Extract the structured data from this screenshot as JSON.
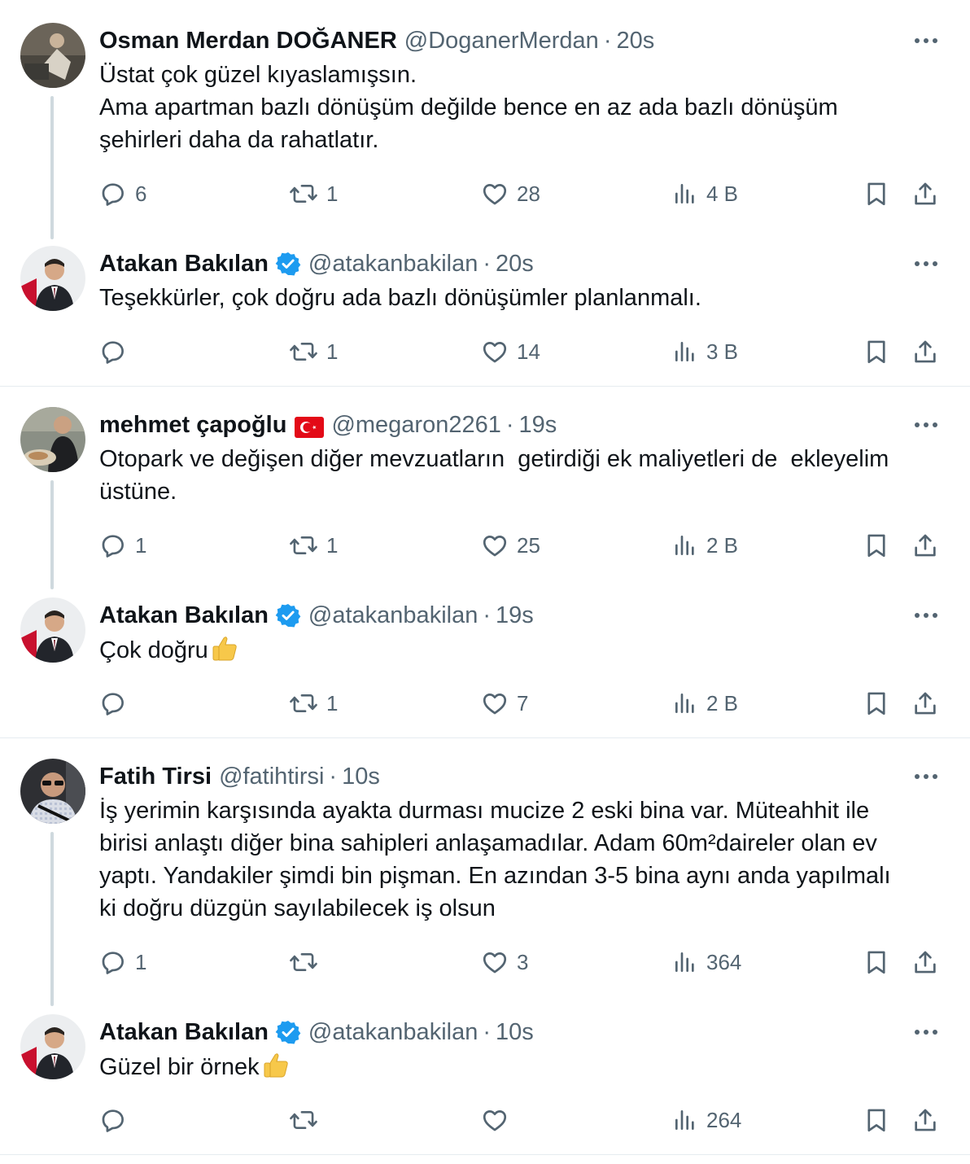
{
  "colors": {
    "text": "#0f1419",
    "muted": "#536471",
    "verified": "#1d9bf0",
    "divider": "#e6ecf0",
    "thread_line": "#cfd9de"
  },
  "tweets": [
    {
      "name": "Osman Merdan DOĞANER",
      "handle": "@DoganerMerdan",
      "time": "20s",
      "verified": false,
      "lines": [
        "Üstat çok güzel kıyaslamışsın.",
        "Ama apartman bazlı dönüşüm değilde bence en az ada bazlı dönüşüm",
        "şehirleri daha da rahatlatır."
      ],
      "replies": "6",
      "reposts": "1",
      "likes": "28",
      "views": "4 B"
    },
    {
      "name": "Atakan Bakılan",
      "handle": "@atakanbakilan",
      "time": "20s",
      "verified": true,
      "lines": [
        "Teşekkürler, çok doğru ada bazlı dönüşümler planlanmalı."
      ],
      "replies": "",
      "reposts": "1",
      "likes": "14",
      "views": "3 B"
    },
    {
      "name": "mehmet çapoğlu",
      "handle": "@megaron2261",
      "time": "19s",
      "verified": false,
      "flag": "turkey-flag",
      "lines": [
        "Otopark ve değişen diğer mevzuatların  getirdiği ek maliyetleri de  ekleyelim",
        "üstüne."
      ],
      "replies": "1",
      "reposts": "1",
      "likes": "25",
      "views": "2 B"
    },
    {
      "name": "Atakan Bakılan",
      "handle": "@atakanbakilan",
      "time": "19s",
      "verified": true,
      "lines": [
        "Çok doğru"
      ],
      "emoji": "thumbs-up-emoji",
      "replies": "",
      "reposts": "1",
      "likes": "7",
      "views": "2 B"
    },
    {
      "name": "Fatih Tirsi",
      "handle": "@fatihtirsi",
      "time": "10s",
      "verified": false,
      "lines": [
        "İş yerimin karşısında ayakta durması mucize 2 eski bina var. Müteahhit ile",
        "birisi anlaştı diğer bina sahipleri anlaşamadılar. Adam 60m²daireler olan ev",
        "yaptı. Yandakiler şimdi bin pişman. En azından 3-5 bina aynı anda yapılmalı",
        "ki doğru düzgün sayılabilecek iş olsun"
      ],
      "replies": "1",
      "reposts": "",
      "likes": "3",
      "views": "364"
    },
    {
      "name": "Atakan Bakılan",
      "handle": "@atakanbakilan",
      "time": "10s",
      "verified": true,
      "lines": [
        "Güzel bir örnek"
      ],
      "emoji": "thumbs-up-emoji",
      "replies": "",
      "reposts": "",
      "likes": "",
      "views": "264"
    }
  ],
  "icons": {
    "more": "more-icon",
    "reply": "reply-icon",
    "repost": "repost-icon",
    "like": "like-icon",
    "views": "views-icon",
    "bookmark": "bookmark-icon",
    "share": "share-icon"
  }
}
